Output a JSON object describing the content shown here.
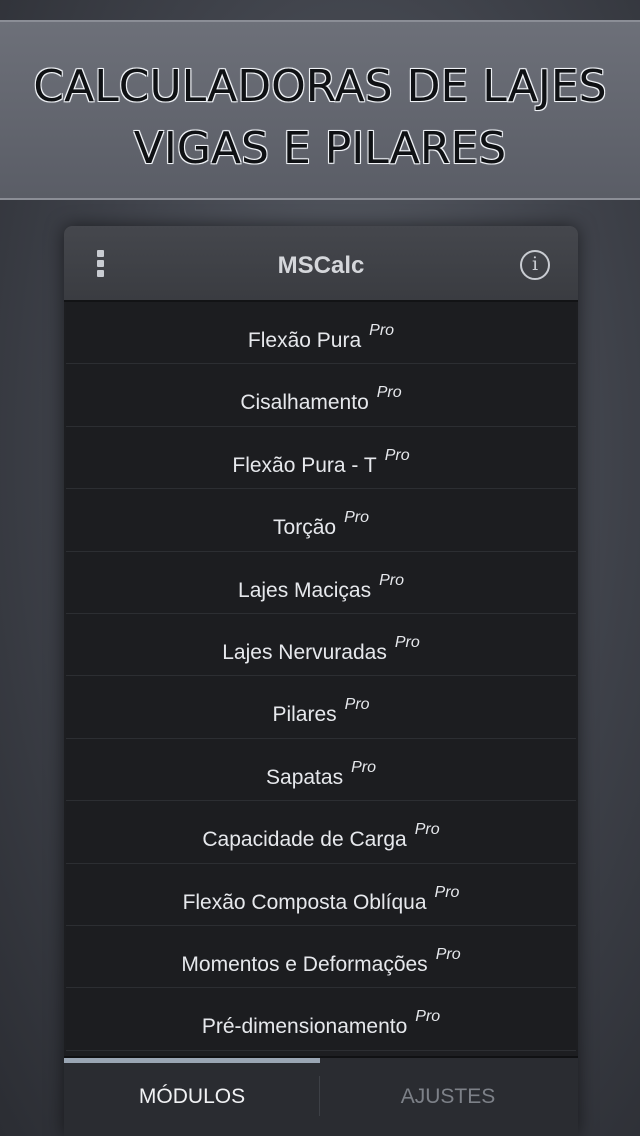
{
  "banner": {
    "line1": "CALCULADORAS DE LAJES",
    "line2": "VIGAS E PILARES"
  },
  "appbar": {
    "title": "MSCalc",
    "menu_icon": "overflow-menu-icon",
    "info_icon": "info-icon",
    "info_glyph": "i"
  },
  "modules": [
    {
      "label": "Flexão Pura",
      "badge": "Pro"
    },
    {
      "label": "Cisalhamento",
      "badge": "Pro"
    },
    {
      "label": "Flexão Pura - T",
      "badge": "Pro"
    },
    {
      "label": "Torção",
      "badge": "Pro"
    },
    {
      "label": "Lajes Maciças",
      "badge": "Pro"
    },
    {
      "label": "Lajes Nervuradas",
      "badge": "Pro"
    },
    {
      "label": "Pilares",
      "badge": "Pro"
    },
    {
      "label": "Sapatas",
      "badge": "Pro"
    },
    {
      "label": "Capacidade de Carga",
      "badge": "Pro"
    },
    {
      "label": "Flexão Composta Oblíqua",
      "badge": "Pro"
    },
    {
      "label": "Momentos e Deformações",
      "badge": "Pro"
    },
    {
      "label": "Pré-dimensionamento",
      "badge": "Pro"
    }
  ],
  "tabs": {
    "modulos": "MÓDULOS",
    "ajustes": "AJUSTES",
    "active": "MÓDULOS"
  },
  "colors": {
    "background": "#3e4149",
    "list_background": "#1c1d20",
    "accent_indicator": "#9aa6b4",
    "inactive_tab_text": "#7d8188"
  }
}
